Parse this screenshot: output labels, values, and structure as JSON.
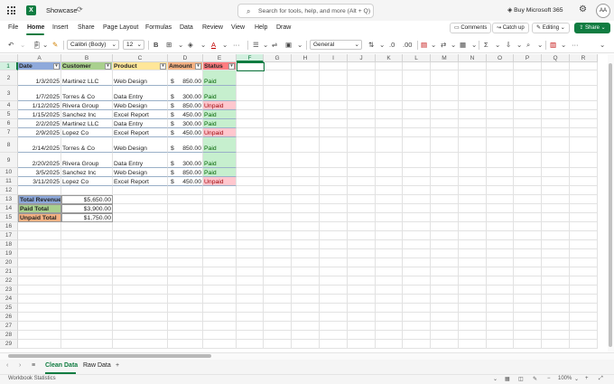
{
  "titlebar": {
    "app_icon": "X",
    "doc_title": "Showcase",
    "sync_icon": "cloud-sync-icon",
    "search_placeholder": "Search for tools, help, and more (Alt + Q)",
    "buy_label": "Buy Microsoft 365",
    "avatar_initials": "AA"
  },
  "menubar": {
    "items": [
      "File",
      "Home",
      "Insert",
      "Share",
      "Page Layout",
      "Formulas",
      "Data",
      "Review",
      "View",
      "Help",
      "Draw"
    ],
    "comments_label": "Comments",
    "catchup_label": "Catch up",
    "editing_label": "Editing",
    "share_label": "Share"
  },
  "ribbon": {
    "font_name": "Calibri (Body)",
    "font_size": "12",
    "number_format": "General",
    "bold_label": "B",
    "text_color": "#c00000",
    "fill_color": "#ffff00"
  },
  "columns": [
    "A",
    "B",
    "C",
    "D",
    "E",
    "F",
    "G",
    "H",
    "I",
    "J",
    "K",
    "L",
    "M",
    "N",
    "O",
    "P",
    "Q",
    "R"
  ],
  "rows": [
    "1",
    "2",
    "3",
    "4",
    "5",
    "6",
    "7",
    "8",
    "9",
    "10",
    "11",
    "12",
    "13",
    "14",
    "15",
    "16",
    "17",
    "18",
    "19",
    "20",
    "21",
    "22",
    "23",
    "24",
    "25",
    "26",
    "27",
    "28",
    "29"
  ],
  "table": {
    "headers": [
      "Date",
      "Customer",
      "Product",
      "Amount",
      "Status"
    ],
    "rows": [
      {
        "date": "1/3/2025",
        "customer": "Martinez LLC",
        "product": "Web Design",
        "currency": "$",
        "amount": "850.00",
        "status": "Paid"
      },
      {
        "date": "1/7/2025",
        "customer": "Torres & Co",
        "product": "Data Entry",
        "currency": "$",
        "amount": "300.00",
        "status": "Paid"
      },
      {
        "date": "1/12/2025",
        "customer": "Rivera Group",
        "product": "Web Design",
        "currency": "$",
        "amount": "850.00",
        "status": "Unpaid"
      },
      {
        "date": "1/15/2025",
        "customer": "Sanchez Inc",
        "product": "Excel Report",
        "currency": "$",
        "amount": "450.00",
        "status": "Paid"
      },
      {
        "date": "2/2/2025",
        "customer": "Martinez LLC",
        "product": "Data Entry",
        "currency": "$",
        "amount": "300.00",
        "status": "Paid"
      },
      {
        "date": "2/9/2025",
        "customer": "Lopez Co",
        "product": "Excel Report",
        "currency": "$",
        "amount": "450.00",
        "status": "Unpaid"
      },
      {
        "date": "2/14/2025",
        "customer": "Torres & Co",
        "product": "Web Design",
        "currency": "$",
        "amount": "850.00",
        "status": "Paid"
      },
      {
        "date": "2/20/2025",
        "customer": "Rivera Group",
        "product": "Data Entry",
        "currency": "$",
        "amount": "300.00",
        "status": "Paid"
      },
      {
        "date": "3/5/2025",
        "customer": "Sanchez Inc",
        "product": "Web Design",
        "currency": "$",
        "amount": "850.00",
        "status": "Paid"
      },
      {
        "date": "3/11/2025",
        "customer": "Lopez Co",
        "product": "Excel Report",
        "currency": "$",
        "amount": "450.00",
        "status": "Unpaid"
      }
    ]
  },
  "summary": [
    {
      "label": "Total Revenue",
      "value": "$5,650.00"
    },
    {
      "label": "Paid Total",
      "value": "$3,900.00"
    },
    {
      "label": "Unpaid Total",
      "value": "$1,750.00"
    }
  ],
  "colors": {
    "header_date": "#8ea9db",
    "header_customer": "#a9d08e",
    "header_product": "#ffe699",
    "header_amount": "#f4b183",
    "header_status": "#ff7c80",
    "summary_revenue": "#8ea9db",
    "summary_paid": "#a9d08e",
    "summary_unpaid": "#f4b183",
    "paid_bg": "#c6efce",
    "unpaid_bg": "#ffc7ce",
    "accent": "#107c41"
  },
  "sheets": {
    "tabs": [
      "Clean Data",
      "Raw Data"
    ],
    "active": "Clean Data"
  },
  "statusbar": {
    "left_label": "Workbook Statistics",
    "zoom": "100%"
  }
}
